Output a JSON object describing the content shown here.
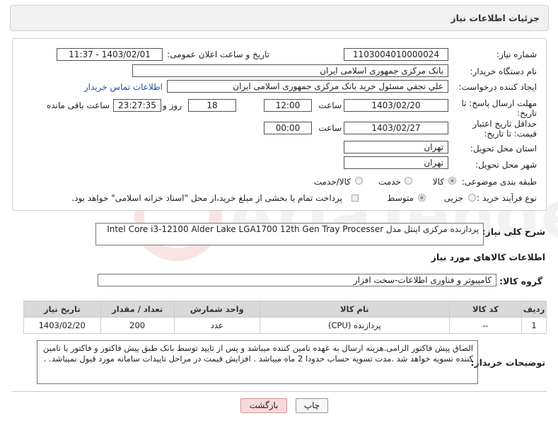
{
  "header": {
    "title": "جزئیات اطلاعات نیاز"
  },
  "form": {
    "need_number_label": "شماره نیاز:",
    "need_number_value": "1103004010000024",
    "announce_label": "تاریخ و ساعت اعلان عمومی:",
    "announce_value": "1403/02/01 - 11:37",
    "buyer_org_label": "نام دستگاه خریدار:",
    "buyer_org_value": "بانک مرکزی جمهوری اسلامی ایران",
    "creator_label": "ایجاد کننده درخواست:",
    "creator_value": "علي  نجفي مسئول خريد بانک مرکزی جمهوری اسلامی ایران",
    "contact_link": "اطلاعات تماس خریدار",
    "deadline_label": "مهلت ارسال پاسخ: تا تاریخ:",
    "deadline_date": "1403/02/20",
    "time_label": "ساعت",
    "deadline_time": "12:00",
    "days_value": "18",
    "day_word": "روز و",
    "remaining_value": "23:27:35",
    "remaining_label": "ساعت باقی مانده",
    "validity_label": "حداقل تاریخ اعتبار قیمت: تا تاریخ:",
    "validity_date": "1403/02/27",
    "validity_time": "00:00",
    "province_label": "استان محل تحویل:",
    "province_value": "تهران",
    "city_label": "شهر محل تحویل:",
    "city_value": "تهران",
    "category_label": "طبقه بندی موضوعی:",
    "category_options": [
      "کالا",
      "خدمت",
      "کالا/خدمت"
    ],
    "process_label": "نوع فرآیند خرید :",
    "process_options": [
      "جزیی",
      "متوسط"
    ],
    "payment_text": "پرداخت تمام یا بخشی از مبلغ خرید،از محل \"اسناد خزانه اسلامی\" خواهد بود."
  },
  "summary": {
    "label": "شرح کلی نیاز:",
    "value": "پردازنده مرکزی اینتل مدل  Intel Core i3-12100 Alder Lake LGA1700 12th Gen Tray Processer"
  },
  "goods": {
    "section_title": "اطلاعات کالاهای مورد نیاز",
    "group_label": "گروه کالا:",
    "group_value": "کامپیوتر و فناوری اطلاعات-سخت افزار",
    "columns": [
      "ردیف",
      "کد کالا",
      "نام کالا",
      "واحد شمارش",
      "تعداد / مقدار",
      "تاریخ نیاز"
    ],
    "rows": [
      [
        "1",
        "--",
        "پردازنده (CPU)",
        "عدد",
        "200",
        "1403/02/20"
      ]
    ]
  },
  "buyer_notes": {
    "label": "توضیحات خریدار:",
    "value": "الصاق پیش فاکتور الزامی.هزینه ارسال به عهده تامین کننده میباشد و پس از تایید توسط بانک طبق پیش فاکتور و فاکتور با تامین کننده تسویه خواهد شد .مدت تسویه حساب حدودا 2 ماه میباشد . افزایش قیمت در مراحل تاییدات سامانه مورد قبول نمیباشد.  ."
  },
  "buttons": {
    "print": "چاپ",
    "back": "بازگشت"
  },
  "colors": {
    "link": "#1f4fa8",
    "back_button": "#f9d9d9",
    "header_bg": "#f1f1f1",
    "table_header": "#d9d9d9"
  }
}
